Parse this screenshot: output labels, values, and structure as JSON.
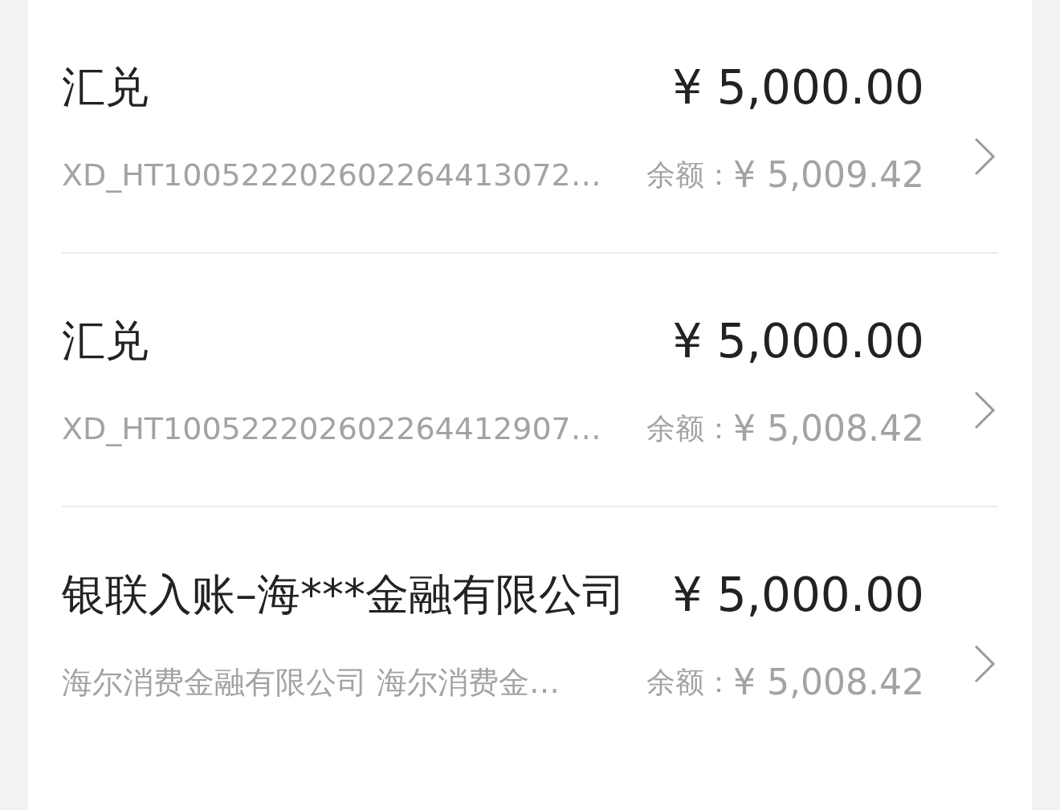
{
  "transactions": [
    {
      "title": "汇兑",
      "amount": "¥ 5,000.00",
      "reference": "XD_HT100522202602264413072…",
      "balance_label": "余额：",
      "balance": "¥ 5,009.42"
    },
    {
      "title": "汇兑",
      "amount": "¥ 5,000.00",
      "reference": "XD_HT100522202602264412907…",
      "balance_label": "余额：",
      "balance": "¥ 5,008.42"
    },
    {
      "title": "银联入账–海***金融有限公司",
      "amount": "¥ 5,000.00",
      "reference": "海尔消费金融有限公司 海尔消费金…",
      "balance_label": "余额：",
      "balance": "¥ 5,008.42"
    }
  ]
}
